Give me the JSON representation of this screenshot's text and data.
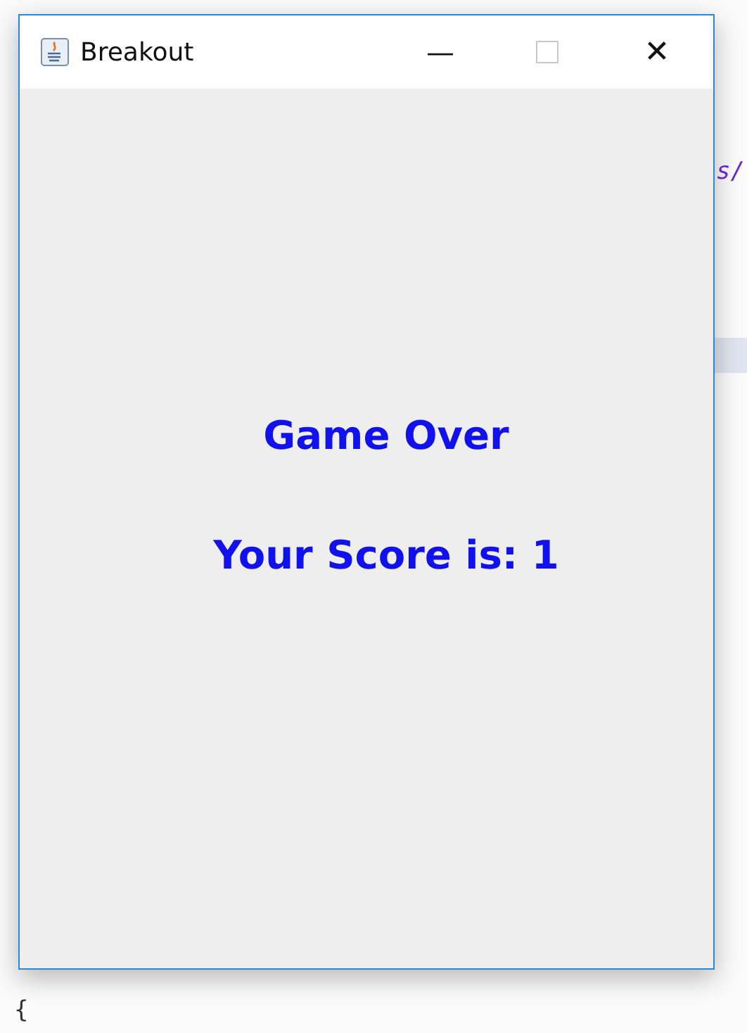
{
  "editor": {
    "fragments": [
      {
        "text": "s/"
      },
      {
        "text": "{"
      }
    ]
  },
  "window": {
    "title": "Breakout",
    "controls": {
      "minimize": "—",
      "close": "✕"
    }
  },
  "game": {
    "lines": [
      "Game Over",
      "Your Score is: 1"
    ]
  }
}
